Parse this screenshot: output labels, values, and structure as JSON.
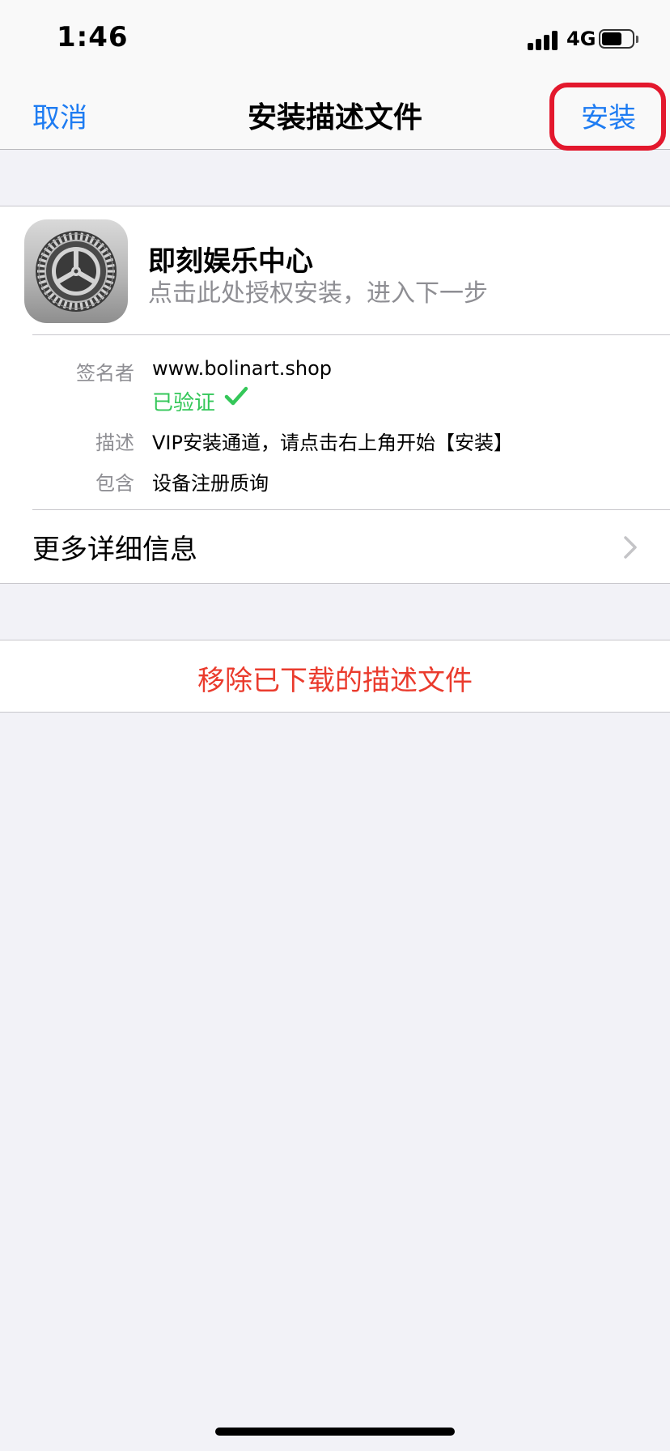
{
  "status_bar": {
    "time": "1:46",
    "network": "4G"
  },
  "nav": {
    "cancel_label": "取消",
    "title": "安装描述文件",
    "install_label": "安装"
  },
  "profile": {
    "name": "即刻娱乐中心",
    "subtitle": "点击此处授权安装，进入下一步",
    "icon": "settings-gear-icon",
    "signer_label": "签名者",
    "signer_value": "www.bolinart.shop",
    "verified_label": "已验证",
    "description_label": "描述",
    "description_value": "VIP安装通道，请点击右上角开始【安装】",
    "contains_label": "包含",
    "contains_value": "设备注册质询",
    "more_details_label": "更多详细信息"
  },
  "remove_label": "移除已下载的描述文件",
  "colors": {
    "accent": "#1e7cf2",
    "verified": "#34c759",
    "destructive": "#ea3b2d",
    "highlight": "#e3182d"
  }
}
